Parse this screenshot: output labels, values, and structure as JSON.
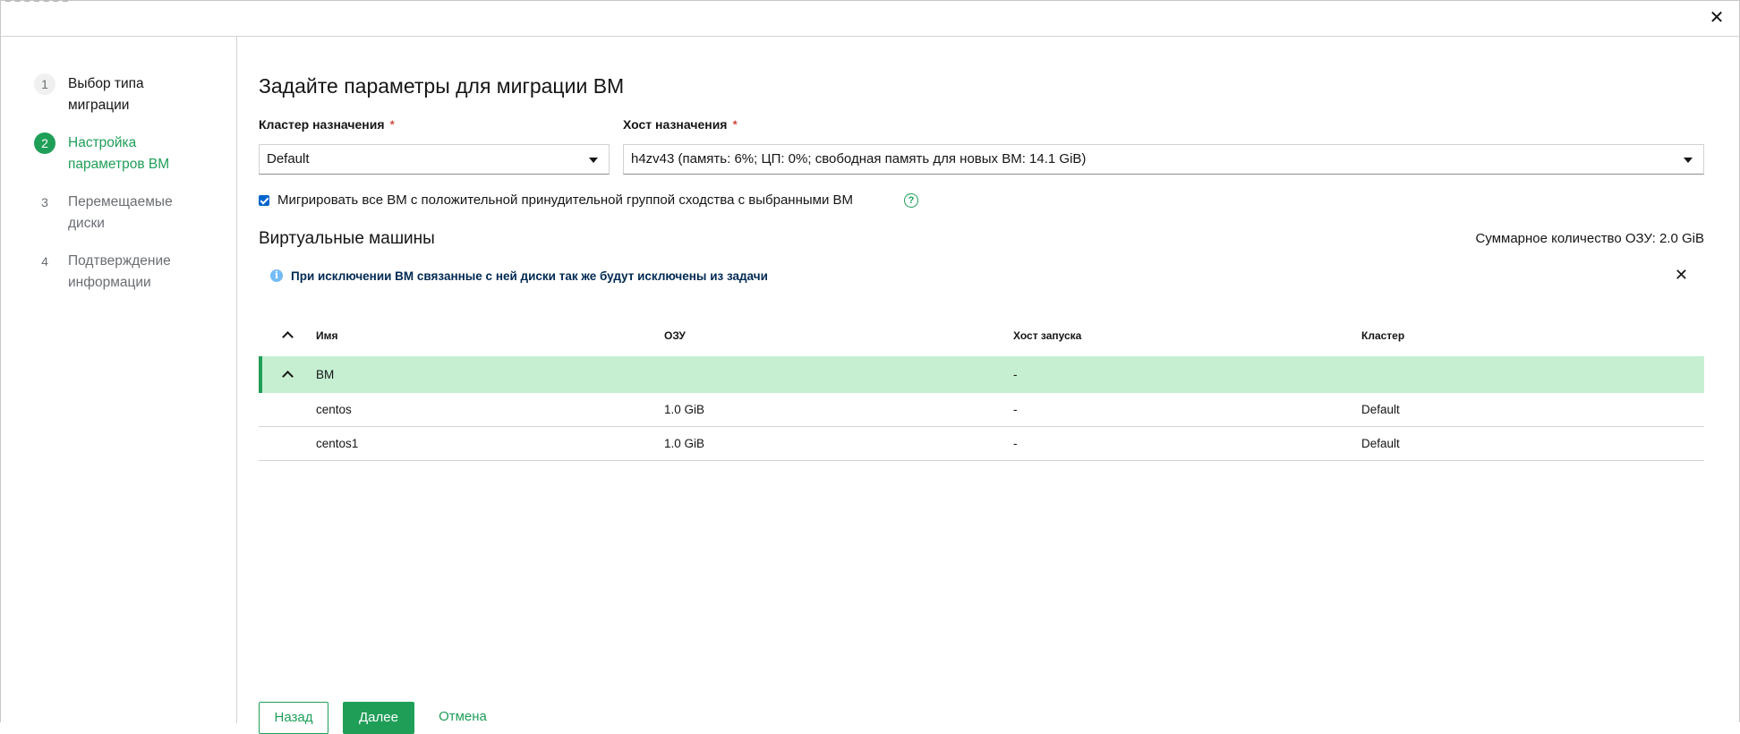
{
  "dialog": {
    "close_glyph": "✕"
  },
  "wizard": {
    "steps": [
      {
        "number": "1",
        "label_line1": "Выбор типа",
        "label_line2": "миграции",
        "state": "done"
      },
      {
        "number": "2",
        "label_line1": "Настройка",
        "label_line2": "параметров ВМ",
        "state": "active"
      },
      {
        "number": "3",
        "label_line1": "Перемещаемые",
        "label_line2": "диски",
        "state": "pending"
      },
      {
        "number": "4",
        "label_line1": "Подтверждение",
        "label_line2": "информации",
        "state": "pending"
      }
    ]
  },
  "main": {
    "title": "Задайте параметры для миграции ВМ",
    "cluster_label": "Кластер назначения",
    "cluster_value": "Default",
    "host_label": "Хост назначения",
    "host_value": "h4zv43 (память: 6%; ЦП: 0%; свободная память для новых ВМ: 14.1 GiB)",
    "required_mark": "*",
    "affinity_checkbox_label": "Мигрировать все ВМ с положительной принудительной группой сходства с выбранными ВМ",
    "affinity_checked": true,
    "help_glyph": "?",
    "vm_section_title": "Виртуальные машины",
    "total_ram": "Суммарное количество ОЗУ: 2.0 GiB",
    "alert": {
      "icon": "info-icon",
      "glyph": "i",
      "message": "При исключении ВМ связанные с ней диски так же будут исключены из задачи",
      "close_glyph": "✕"
    }
  },
  "table": {
    "columns": [
      "Имя",
      "ОЗУ",
      "Хост запуска",
      "Кластер"
    ],
    "group": {
      "name": "ВМ",
      "ram": "",
      "host": "-",
      "cluster": ""
    },
    "rows": [
      {
        "name": "centos",
        "ram": "1.0 GiB",
        "host": "-",
        "cluster": "Default"
      },
      {
        "name": "centos1",
        "ram": "1.0 GiB",
        "host": "-",
        "cluster": "Default"
      }
    ]
  },
  "footer": {
    "back_label": "Назад",
    "next_label": "Далее",
    "cancel_label": "Отмена"
  },
  "colors": {
    "accent": "#1f9e58",
    "group_row_bg": "#c6efd2",
    "checkbox": "#0066cc",
    "info": "#73bcf7"
  }
}
